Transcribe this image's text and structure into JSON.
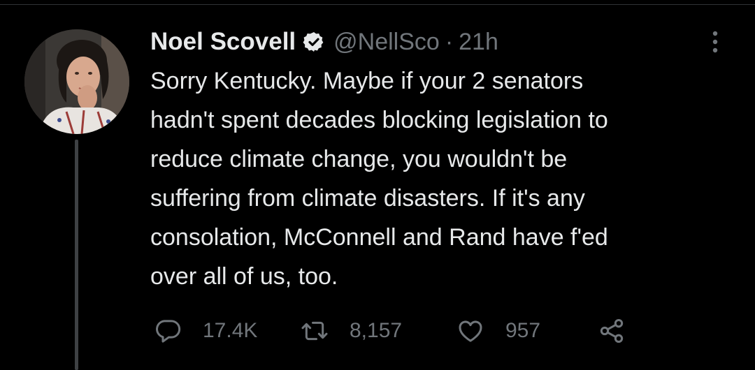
{
  "tweet": {
    "author_name": "Noel Scovell",
    "verified_icon": "verified-badge-icon",
    "handle": "@NellSco",
    "separator": "·",
    "time": "21h",
    "text": "Sorry Kentucky. Maybe if your 2 senators\nhadn't spent decades blocking legislation to\nreduce climate change, you wouldn't be\nsuffering from climate disasters. If it's any\nconsolation, McConnell and Rand have f'ed\nover all of us, too."
  },
  "actions": {
    "reply_count": "17.4K",
    "retweet_count": "8,157",
    "like_count": "957"
  },
  "colors": {
    "background": "#000000",
    "text_primary": "#e7e9ea",
    "text_secondary": "#71767b",
    "thread_line": "#3e4144"
  }
}
